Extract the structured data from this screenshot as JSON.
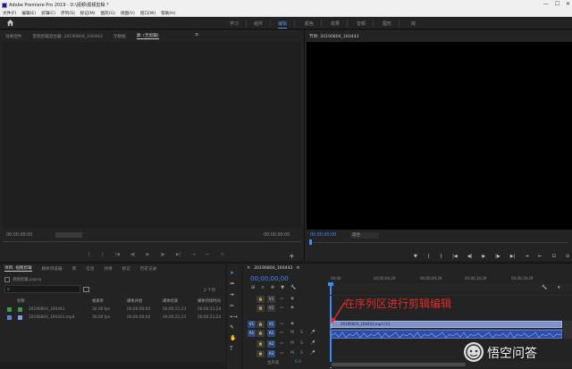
{
  "window": {
    "title": "Adobe Premiere Pro 2019 - D:\\视频\\视频剪辑 *",
    "controls": [
      "—",
      "☐",
      "✕"
    ]
  },
  "menu": [
    "文件(F)",
    "编辑(E)",
    "剪辑(C)",
    "序列(S)",
    "标记(M)",
    "图形(G)",
    "视图(V)",
    "窗口(W)",
    "帮助(H)"
  ],
  "workspaces": [
    {
      "label": "学习",
      "active": false
    },
    {
      "label": "组件",
      "active": false
    },
    {
      "label": "编辑",
      "active": true
    },
    {
      "label": "颜色",
      "active": false
    },
    {
      "label": "效果",
      "active": false
    },
    {
      "label": "音频",
      "active": false
    },
    {
      "label": "图形",
      "active": false
    },
    {
      "label": "库",
      "active": false
    }
  ],
  "source_panel": {
    "tabs": [
      "效果控件",
      "音频剪辑混合器: 20190804_160443",
      "元数据",
      "源: (无剪辑)"
    ],
    "timecode_left": "00;00;00;00",
    "timecode_right": "00;00;00;00"
  },
  "program_panel": {
    "title": "节目: 20190804_160443",
    "timecode_left": "00;00;00;00",
    "fit": "适合",
    "transport_icons": [
      "▼",
      "{",
      "}",
      "|◀",
      "◀|",
      "▶",
      "|▶",
      "▶|",
      "⇥",
      "⇤",
      "⊡",
      "⊙"
    ]
  },
  "project_panel": {
    "tabs": [
      "项目: 视频剪辑",
      "媒体浏览器",
      "库",
      "信息",
      "效果",
      "标记",
      "历史记录"
    ],
    "project_file": "视频剪辑.prproj",
    "item_count": "2 个项",
    "columns": [
      "名称",
      "帧速率",
      "媒体开始",
      "媒体结束",
      "媒体持续时间"
    ],
    "rows": [
      {
        "name": "20190804_160443",
        "fps": "30.00 fps",
        "start": "00;00;00;00",
        "end": "00;00;21;23",
        "duration": "00;00;21;24",
        "color": "#3e9b4a"
      },
      {
        "name": "20190804_160443.mp4",
        "fps": "30.00 fps",
        "start": "00;00;00;00",
        "end": "00;00;21;23",
        "duration": "00;00;21;24",
        "color": "#5f7fd6"
      }
    ]
  },
  "timeline": {
    "sequence_tab": "20190804_160443",
    "timecode": "00;00;00;00",
    "ruler": [
      "00;00",
      "00;00;04;29",
      "00;00;09;29",
      "00;00;14;29",
      "00;00;19;29"
    ],
    "video_tracks": [
      "V3",
      "V2",
      "V1"
    ],
    "audio_tracks": [
      "A1",
      "A2",
      "A3"
    ],
    "master_label": "主声道",
    "master_value": "0.0",
    "clip_label": "20190804_160443.mp4 [V]",
    "annotation": "在序列区进行剪辑编辑"
  },
  "watermark": {
    "text": "悟空问答"
  },
  "colors": {
    "accent_blue": "#3d8af7",
    "annotation_red": "#e02b2b",
    "video_clip": "#7f92c8",
    "audio_clip": "#2d4ea7"
  }
}
